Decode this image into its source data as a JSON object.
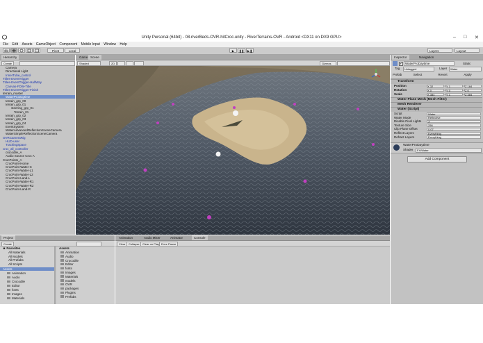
{
  "window": {
    "title": "Unity Personal (64bit) - 08.riverBeds-OVR-hitCroc.unity - RiverTerrains-OVR - Android <DX11 on DX9 GPU>",
    "controls": [
      "–",
      "□",
      "✕"
    ]
  },
  "menu": [
    "File",
    "Edit",
    "Assets",
    "GameObject",
    "Component",
    "Mobile Input",
    "Window",
    "Help"
  ],
  "toolbar": {
    "pivot": "Pivot",
    "local": "Local",
    "play": "▶",
    "pause": "❚❚",
    "step": "▶❚",
    "layers": "Layers",
    "layout": "Layout"
  },
  "hierarchy": {
    "tab": "Hierarchy",
    "create": "Create",
    "rows": [
      {
        "text": "Camera",
        "indent": 1,
        "style": ""
      },
      {
        "text": "Directional Light",
        "indent": 1,
        "style": ""
      },
      {
        "text": "InnerTube_control",
        "indent": 1,
        "style": "blue"
      },
      {
        "text": "Titles-EventTrigger",
        "indent": 0,
        "style": "blue"
      },
      {
        "text": "Titles-EventTrigger-HalfWay",
        "indent": 0,
        "style": "blue"
      },
      {
        "text": "Canvas-FDW-Title",
        "indent": 1,
        "style": "blue"
      },
      {
        "text": "Titles-EventTrigger-Finish",
        "indent": 0,
        "style": "blue"
      },
      {
        "text": "terrain_master",
        "indent": 0,
        "style": ""
      },
      {
        "text": "WaterProDaytime",
        "indent": 1,
        "style": "sel"
      },
      {
        "text": "terrain_grp_00",
        "indent": 1,
        "style": ""
      },
      {
        "text": "terrain_grp_01",
        "indent": 1,
        "style": ""
      },
      {
        "text": "steering_grp_01",
        "indent": 3,
        "style": ""
      },
      {
        "text": "Terrain_01",
        "indent": 4,
        "style": ""
      },
      {
        "text": "terrain_grp_02",
        "indent": 1,
        "style": ""
      },
      {
        "text": "terrain_grp_03",
        "indent": 1,
        "style": ""
      },
      {
        "text": "terrain_grp_04",
        "indent": 1,
        "style": ""
      },
      {
        "text": "EventSystem",
        "indent": 1,
        "style": ""
      },
      {
        "text": "WaterAdvancedReflectionSceneCamera",
        "indent": 1,
        "style": ""
      },
      {
        "text": "WaterSimpleReflectionSceneCamera",
        "indent": 1,
        "style": ""
      },
      {
        "text": "OVRCameraRig",
        "indent": 0,
        "style": "blue"
      },
      {
        "text": "HUD-user",
        "indent": 1,
        "style": "blue"
      },
      {
        "text": "TrackingSpace",
        "indent": 1,
        "style": "blue"
      },
      {
        "text": "croc_all_controller",
        "indent": 0,
        "style": "blue"
      },
      {
        "text": "crocodile_A",
        "indent": 1,
        "style": ""
      },
      {
        "text": "Audio Source Croc A",
        "indent": 1,
        "style": ""
      },
      {
        "text": "CrocPoints_A",
        "indent": 0,
        "style": ""
      },
      {
        "text": "CrocPoint-Home",
        "indent": 1,
        "style": ""
      },
      {
        "text": "CrocPoint-Water-C",
        "indent": 1,
        "style": ""
      },
      {
        "text": "CrocPoint-Water-L1",
        "indent": 1,
        "style": ""
      },
      {
        "text": "CrocPoint-Water-L2",
        "indent": 1,
        "style": ""
      },
      {
        "text": "CrocPoint-Land-L",
        "indent": 1,
        "style": ""
      },
      {
        "text": "CrocPoint-Water-R1",
        "indent": 1,
        "style": ""
      },
      {
        "text": "CrocPoint-Water-R2",
        "indent": 1,
        "style": ""
      },
      {
        "text": "CrocPoint-Land-R",
        "indent": 1,
        "style": ""
      }
    ]
  },
  "scene": {
    "tabs": [
      "Game",
      "Scene"
    ],
    "shaded": "Shaded",
    "mode2d": "2D",
    "gizmos": "Gizmos",
    "search_placeholder": "All"
  },
  "inspector": {
    "tabs": [
      "Inspector",
      "Navigation"
    ],
    "object_name": "WaterProDaytime",
    "static_label": "Static",
    "tag_label": "Tag",
    "tag_value": "Untagged",
    "layer_label": "Layer",
    "layer_value": "Water",
    "prefab_label": "Prefab",
    "prefab_buttons": [
      "Select",
      "Revert",
      "Apply"
    ],
    "transform": {
      "title": "Transform",
      "rows": [
        {
          "label": "Position",
          "x": "X 32",
          "y": "Y 1",
          "z": "Z 184"
        },
        {
          "label": "Rotation",
          "x": "X 0",
          "y": "Y 0",
          "z": "Z 0"
        },
        {
          "label": "Scale",
          "x": "X 384",
          "y": "Y 1",
          "z": "Z 384"
        }
      ]
    },
    "components": [
      "Water Plane Mesh (Mesh Filter)",
      "Mesh Renderer",
      "Water (Script)"
    ],
    "script_rows": [
      {
        "label": "Script",
        "value": "Water"
      },
      {
        "label": "Water Mode",
        "value": "Reflective"
      },
      {
        "label": "Disable Pixel Lights",
        "value": "✔"
      },
      {
        "label": "Texture Size",
        "value": "256"
      },
      {
        "label": "Clip Plane Offset",
        "value": "0.07"
      },
      {
        "label": "Reflect Layers",
        "value": "Everything"
      },
      {
        "label": "Refract Layers",
        "value": "Everything"
      }
    ],
    "material_name": "WaterProDaytime",
    "shader_label": "Shader",
    "shader_value": "FX/Water",
    "add_component": "Add Component"
  },
  "animation_tabs": [
    "Animation",
    "Audio Mixer",
    "Animator",
    "Console"
  ],
  "console": {
    "buttons": [
      "Clear",
      "Collapse",
      "Clear on Play",
      "Error Pause"
    ]
  },
  "project": {
    "tab": "Project",
    "create": "Create",
    "favorites_title": "Favorites",
    "favorites": [
      "All Materials",
      "All Models",
      "All Prefabs",
      "All Scripts"
    ],
    "assets_title": "Assets",
    "tree": [
      "Animation",
      "Audio",
      "Crocodile",
      "Editor",
      "fonts",
      "Images",
      "Materials"
    ],
    "grid_title": "Assets",
    "grid": [
      "Animation",
      "Audio",
      "Crocodile",
      "Editor",
      "fonts",
      "Images",
      "Materials",
      "models",
      "OVR",
      "packages",
      "Plugins",
      "Prefabs"
    ]
  }
}
